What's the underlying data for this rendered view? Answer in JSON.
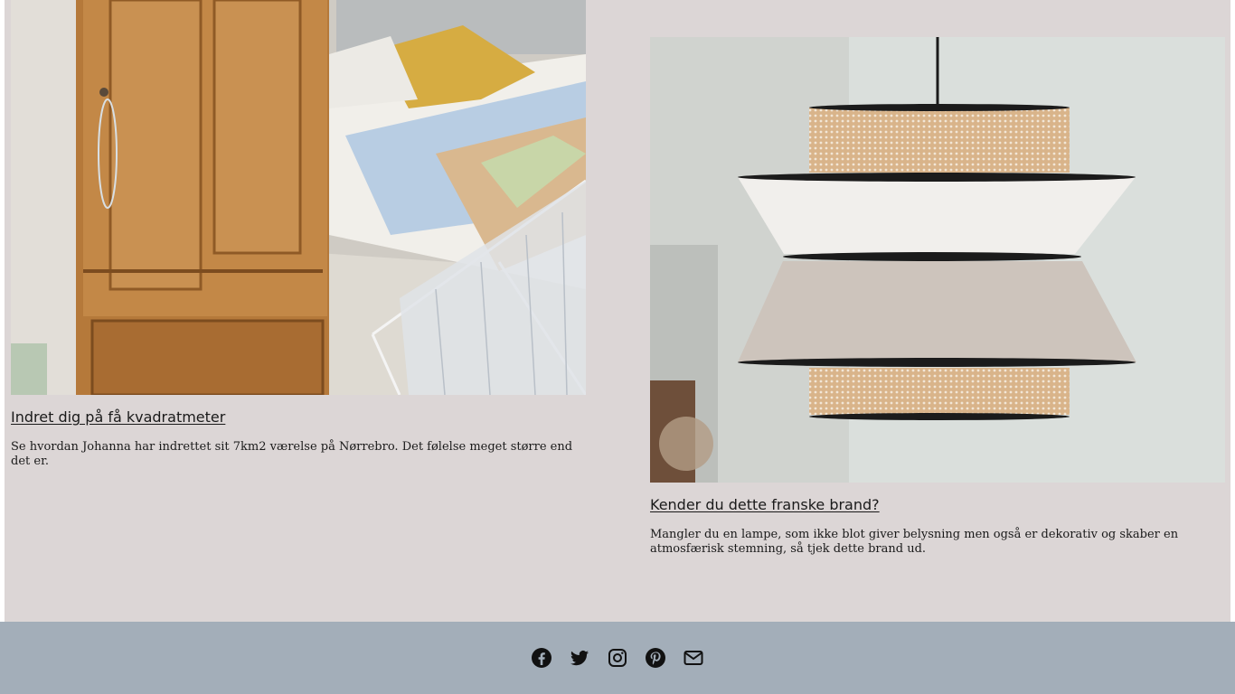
{
  "articles": [
    {
      "title": "Indret dig på få kvadratmeter",
      "description": "Se hvordan Johanna har indrettet sit 7km2 værelse på Nørrebro. Det følelse meget større end det er.",
      "image": "bedroom-with-wooden-wardrobe-image"
    },
    {
      "title": "Kender du dette franske brand?",
      "description": "Mangler du en lampe, som ikke blot giver belysning men også er dekorativ og skaber en atmosfærisk stemning, så tjek dette brand ud.",
      "image": "rattan-pendant-lamp-image"
    }
  ],
  "footer": {
    "social_icons": [
      "facebook-icon",
      "twitter-icon",
      "instagram-icon",
      "pinterest-icon",
      "envelope-icon"
    ]
  },
  "colors": {
    "content_bg": "#dcd6d6",
    "footer_bg": "#a3aeb9",
    "text": "#1a1a1a"
  }
}
